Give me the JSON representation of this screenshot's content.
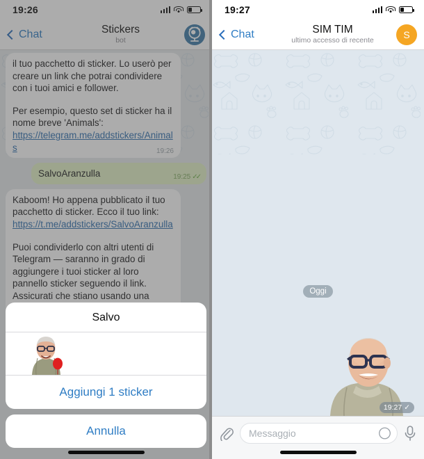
{
  "left_panel": {
    "status_bar": {
      "time": "19:26",
      "signal_icon": "signal-bars-icon",
      "wifi_icon": "wifi-icon",
      "battery_icon": "battery-icon"
    },
    "header": {
      "back_label": "Chat",
      "title": "Stickers",
      "subtitle": "bot",
      "avatar_icon": "sticker-bot-avatar-icon",
      "avatar_color": "#3c7ba8"
    },
    "messages": [
      {
        "type": "incoming",
        "para1": "il tuo pacchetto di sticker. Lo userò per creare un link che potrai condividere con i tuoi amici e follower.",
        "para2_pre": "Per esempio, questo set di sticker ha il nome breve 'Animals': ",
        "para2_link": "https://telegram.me/addstickers/Animals",
        "time": "19:26"
      },
      {
        "type": "outgoing",
        "text": "SalvoAranzulla",
        "time": "19:25",
        "check": "✓✓"
      },
      {
        "type": "incoming",
        "para1_pre": "Kaboom! Ho appena pubblicato il tuo pacchetto di sticker. Ecco il tuo link: ",
        "para1_link": "https://t.me/addstickers/SalvoAranzulla",
        "para2": "Puoi condividerlo con altri utenti di Telegram — saranno in grado di aggiungere i tuoi sticker al loro pannello sticker seguendo il link. Assicurati che stiano usando una versione aggiornata dell'app."
      }
    ],
    "action_sheet": {
      "title": "Salvo",
      "sticker_preview_icon": "sticker-preview-salvo",
      "add_button": "Aggiungi 1 sticker",
      "cancel_button": "Annulla"
    }
  },
  "right_panel": {
    "status_bar": {
      "time": "19:27",
      "signal_icon": "signal-bars-icon",
      "wifi_icon": "wifi-icon",
      "battery_icon": "battery-icon"
    },
    "header": {
      "back_label": "Chat",
      "title": "SIM TIM",
      "subtitle": "ultimo accesso di recente",
      "avatar_letter": "S",
      "avatar_color": "#f5a623"
    },
    "date_separator": "Oggi",
    "sticker_message": {
      "sticker_icon": "sticker-salvo-photo",
      "time": "19:27",
      "check": "✓"
    },
    "input_bar": {
      "attach_icon": "paperclip-icon",
      "placeholder": "Messaggio",
      "sticker_icon": "sticker-smiley-icon",
      "mic_icon": "microphone-icon"
    }
  },
  "colors": {
    "accent_blue": "#2f7dc4",
    "outgoing_bubble": "#e3f3c7",
    "chat_background": "#dfe7ee",
    "bot_avatar": "#3c7ba8",
    "user_avatar": "#f5a623"
  }
}
